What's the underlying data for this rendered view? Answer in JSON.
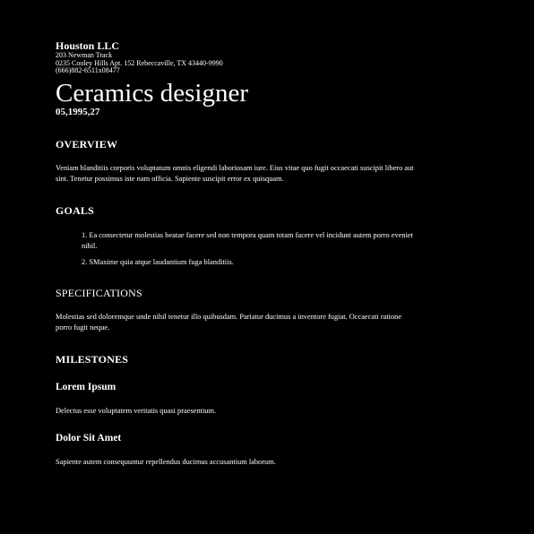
{
  "company": {
    "name": "Houston LLC",
    "address_line1": "203 Newman Track",
    "address_line2": "0235 Cooley Hills Apt. 152 Rebeccaville, TX 43440-9990",
    "phone": "(666)882-6511x08477"
  },
  "document": {
    "title": "Ceramics designer",
    "date": "05,1995,27"
  },
  "overview": {
    "heading": "OVERVIEW",
    "text": "Veniam blanditiis corporis voluptatum omnis eligendi laboriosam iure. Eius vitae quo fugit occaecati suscipit libero aut sint. Tenetur possimus iste nam officia. Sapiente suscipit error ex quisquam."
  },
  "goals": {
    "heading": "GOALS",
    "items": [
      "1. Ea consectetur molestias beatae facere sed non tempora quam totam facere vel incidunt autem porro eveniet nihil.",
      "2. SMaxime quia atque laudantium fuga blanditiis."
    ]
  },
  "specifications": {
    "heading": "SPECIFICATIONS",
    "text": "Molestias sed doloremque unde nihil tenetur illo quibusdam. Pariatur ducimus a inventore fugiat. Occaecati ratione porro fugit neque."
  },
  "milestones": {
    "heading": "MILESTONES",
    "items": [
      {
        "title": "Lorem Ipsum",
        "text": "Delectus esse voluptatem veritatis quasi praesentium."
      },
      {
        "title": "Dolor Sit Amet",
        "text": "Sapiente autem consequuntur repellendus ducimus accusantium laborum."
      }
    ]
  }
}
